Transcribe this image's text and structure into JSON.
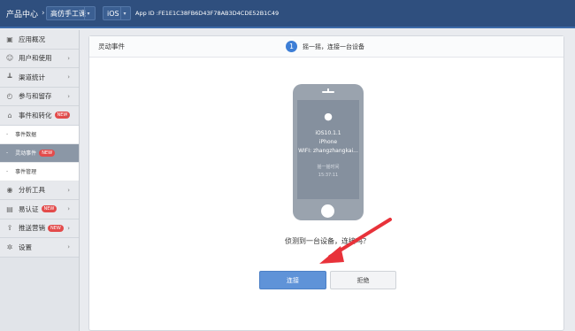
{
  "topbar": {
    "brand": "产品中心",
    "app_name": "高仿手工课",
    "platform": "iOS",
    "app_id": "App ID :FE1E1C38FB6D43F78AB3D4CDE52B1C49"
  },
  "sidebar": {
    "items": [
      {
        "label": "应用概况",
        "icon": "overview-icon",
        "arrow": false
      },
      {
        "label": "用户和使用",
        "icon": "users-icon",
        "arrow": true
      },
      {
        "label": "渠道统计",
        "icon": "channel-icon",
        "arrow": true
      },
      {
        "label": "参与和留存",
        "icon": "retention-icon",
        "arrow": true
      },
      {
        "label": "事件和转化",
        "icon": "event-icon",
        "badge": "NEW",
        "arrow": true
      }
    ],
    "subitems": [
      {
        "label": "事件数据"
      },
      {
        "label": "灵动事件",
        "badge": "NEW",
        "active": true
      },
      {
        "label": "事件管理"
      }
    ],
    "items2": [
      {
        "label": "分析工具",
        "icon": "eye-icon",
        "arrow": true
      },
      {
        "label": "易认证",
        "icon": "cert-icon",
        "badge": "NEW",
        "arrow": true
      },
      {
        "label": "推送营销",
        "icon": "push-icon",
        "badge": "NEW",
        "arrow": true
      },
      {
        "label": "设置",
        "icon": "gear-icon",
        "arrow": true
      }
    ]
  },
  "main": {
    "title": "灵动事件",
    "step_number": "1",
    "step_text": "摇一摇，连接一台设备",
    "phone": {
      "version": "iOS10.1.1",
      "model": "iPhone",
      "wifi": "WIFI: zhangzhangkai...",
      "shake_label": "摇一摇时间",
      "shake_time": "15:37:11"
    },
    "question": "侦测到一台设备，连接吗？",
    "connect_label": "连接",
    "refuse_label": "拒绝"
  },
  "colors": {
    "topbar": "#2f4f7e",
    "accent": "#3d7ed6",
    "badge": "#e34b4b",
    "arrow": "#e8323a"
  }
}
